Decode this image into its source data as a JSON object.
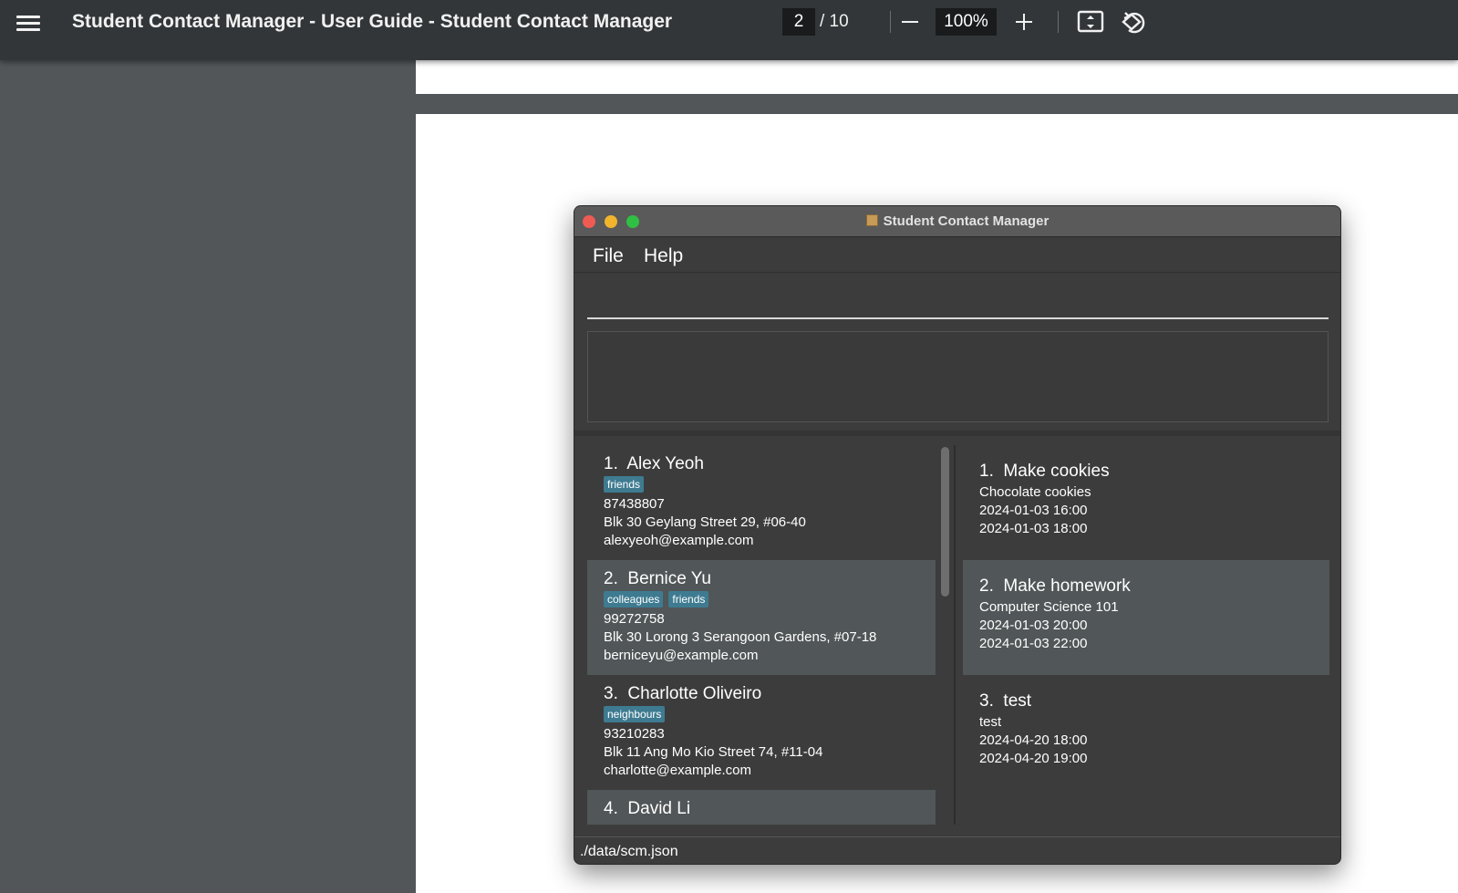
{
  "viewer": {
    "title": "Student Contact Manager - User Guide - Student Contact Manager",
    "current_page": "2",
    "page_total": "/ 10",
    "zoom": "100%"
  },
  "app": {
    "window_title": "Student Contact Manager",
    "menu": {
      "file": "File",
      "help": "Help"
    },
    "command_value": "",
    "result_text": "",
    "status_path": "./data/scm.json",
    "contacts": [
      {
        "index": "1.",
        "name": "Alex Yeoh",
        "tags": [
          "friends"
        ],
        "phone": "87438807",
        "address": "Blk 30 Geylang Street 29, #06-40",
        "email": "alexyeoh@example.com"
      },
      {
        "index": "2.",
        "name": "Bernice Yu",
        "tags": [
          "colleagues",
          "friends"
        ],
        "phone": "99272758",
        "address": "Blk 30 Lorong 3 Serangoon Gardens, #07-18",
        "email": "berniceyu@example.com"
      },
      {
        "index": "3.",
        "name": "Charlotte Oliveiro",
        "tags": [
          "neighbours"
        ],
        "phone": "93210283",
        "address": "Blk 11 Ang Mo Kio Street 74, #11-04",
        "email": "charlotte@example.com"
      },
      {
        "index": "4.",
        "name": "David Li"
      }
    ],
    "events": [
      {
        "index": "1.",
        "title": "Make cookies",
        "description": "Chocolate cookies",
        "start": "2024-01-03 16:00",
        "end": "2024-01-03 18:00"
      },
      {
        "index": "2.",
        "title": "Make homework",
        "description": "Computer Science 101",
        "start": "2024-01-03 20:00",
        "end": "2024-01-03 22:00"
      },
      {
        "index": "3.",
        "title": "test",
        "description": "test",
        "start": "2024-04-20 18:00",
        "end": "2024-04-20 19:00"
      }
    ]
  },
  "colors": {
    "viewer_toolbar": "#323639",
    "viewer_background": "#525659",
    "app_background": "#3c3c3c",
    "selected_row": "#515658",
    "tag": "#3e7b91"
  }
}
